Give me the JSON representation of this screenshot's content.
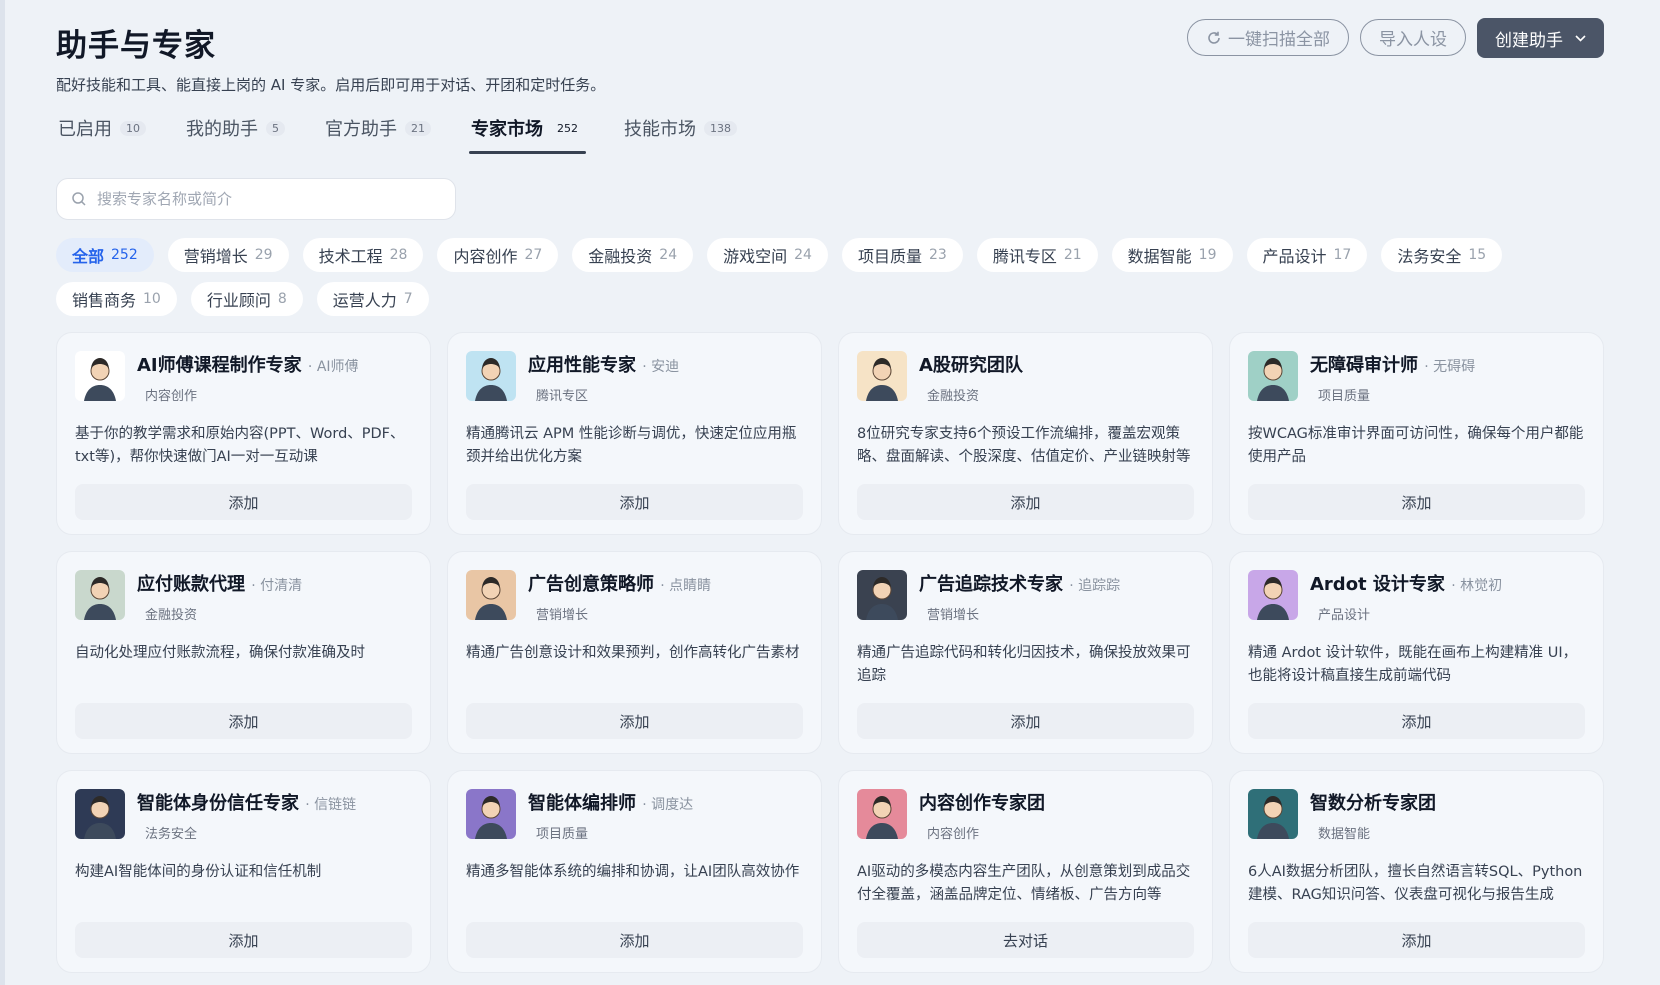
{
  "header": {
    "title": "助手与专家",
    "subtitle": "配好技能和工具、能直接上岗的 AI 专家。启用后即可用于对话、开团和定时任务。",
    "scan_label": "一键扫描全部",
    "import_label": "导入人设",
    "create_label": "创建助手"
  },
  "tabs": [
    {
      "label": "已启用",
      "count": "10"
    },
    {
      "label": "我的助手",
      "count": "5"
    },
    {
      "label": "官方助手",
      "count": "21"
    },
    {
      "label": "专家市场",
      "count": "252"
    },
    {
      "label": "技能市场",
      "count": "138"
    }
  ],
  "search": {
    "placeholder": "搜索专家名称或简介"
  },
  "categories": [
    {
      "label": "全部",
      "count": "252"
    },
    {
      "label": "营销增长",
      "count": "29"
    },
    {
      "label": "技术工程",
      "count": "28"
    },
    {
      "label": "内容创作",
      "count": "27"
    },
    {
      "label": "金融投资",
      "count": "24"
    },
    {
      "label": "游戏空间",
      "count": "24"
    },
    {
      "label": "项目质量",
      "count": "23"
    },
    {
      "label": "腾讯专区",
      "count": "21"
    },
    {
      "label": "数据智能",
      "count": "19"
    },
    {
      "label": "产品设计",
      "count": "17"
    },
    {
      "label": "法务安全",
      "count": "15"
    },
    {
      "label": "销售商务",
      "count": "10"
    },
    {
      "label": "行业顾问",
      "count": "8"
    },
    {
      "label": "运营人力",
      "count": "7"
    }
  ],
  "cards": [
    {
      "name": "AI师傅课程制作专家",
      "by": "· AI师傅",
      "category": "内容创作",
      "desc": "基于你的教学需求和原始内容(PPT、Word、PDF、txt等)，帮你快速做门AI一对一互动课",
      "button": "添加",
      "avatar_color": "#ffffff"
    },
    {
      "name": "应用性能专家",
      "by": "· 安迪",
      "category": "腾讯专区",
      "desc": "精通腾讯云 APM 性能诊断与调优，快速定位应用瓶颈并给出优化方案",
      "button": "添加",
      "avatar_color": "#bfe3f2"
    },
    {
      "name": "A股研究团队",
      "by": "",
      "category": "金融投资",
      "desc": "8位研究专家支持6个预设工作流编排，覆盖宏观策略、盘面解读、个股深度、估值定价、产业链映射等",
      "button": "添加",
      "avatar_color": "#f6e3c6"
    },
    {
      "name": "无障碍审计师",
      "by": "· 无碍碍",
      "category": "项目质量",
      "desc": "按WCAG标准审计界面可访问性，确保每个用户都能使用产品",
      "button": "添加",
      "avatar_color": "#9fd0c6"
    },
    {
      "name": "应付账款代理",
      "by": "· 付清清",
      "category": "金融投资",
      "desc": "自动化处理应付账款流程，确保付款准确及时",
      "button": "添加",
      "avatar_color": "#c9d8cd"
    },
    {
      "name": "广告创意策略师",
      "by": "· 点睛睛",
      "category": "营销增长",
      "desc": "精通广告创意设计和效果预判，创作高转化广告素材",
      "button": "添加",
      "avatar_color": "#e9c6a5"
    },
    {
      "name": "广告追踪技术专家",
      "by": "· 追踪踪",
      "category": "营销增长",
      "desc": "精通广告追踪代码和转化归因技术，确保投放效果可追踪",
      "button": "添加",
      "avatar_color": "#3a4250"
    },
    {
      "name": "Ardot 设计专家",
      "by": "· 林觉初",
      "category": "产品设计",
      "desc": "精通 Ardot 设计软件，既能在画布上构建精准 UI，也能将设计稿直接生成前端代码",
      "button": "添加",
      "avatar_color": "#c8a7e8"
    },
    {
      "name": "智能体身份信任专家",
      "by": "· 信链链",
      "category": "法务安全",
      "desc": "构建AI智能体间的身份认证和信任机制",
      "button": "添加",
      "avatar_color": "#2e3a55"
    },
    {
      "name": "智能体编排师",
      "by": "· 调度达",
      "category": "项目质量",
      "desc": "精通多智能体系统的编排和协调，让AI团队高效协作",
      "button": "添加",
      "avatar_color": "#8a76c9"
    },
    {
      "name": "内容创作专家团",
      "by": "",
      "category": "内容创作",
      "desc": "AI驱动的多模态内容生产团队，从创意策划到成品交付全覆盖，涵盖品牌定位、情绪板、广告方向等",
      "button": "去对话",
      "avatar_color": "#e58a9a"
    },
    {
      "name": "智数分析专家团",
      "by": "",
      "category": "数据智能",
      "desc": "6人AI数据分析团队，擅长自然语言转SQL、Python建模、RAG知识问答、仪表盘可视化与报告生成",
      "button": "添加",
      "avatar_color": "#2f6f78"
    }
  ]
}
